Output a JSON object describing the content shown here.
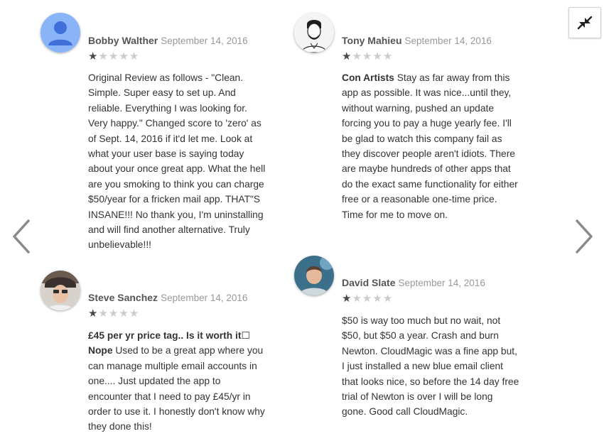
{
  "reviews": [
    {
      "name": "Bobby Walther",
      "date": "September 14, 2016",
      "rating": 1,
      "title": "",
      "text": "Original Review as follows - \"Clean. Simple. Super easy to set up. And reliable. Everything I was looking for. Very happy.\" Changed score to 'zero' as of Sept. 14, 2016 if it'd let me. Look at what your user base is saying today about your once great app. What the hell are you smoking to think you can charge $50/year for a fricken mail app. THAT\"S INSANE!!! No thank you, I'm uninstalling and will find another alternative. Truly unbelievable!!!"
    },
    {
      "name": "Tony Mahieu",
      "date": "September 14, 2016",
      "rating": 1,
      "title": "Con Artists",
      "text": "Stay as far away from this app as possible. It was nice...until they, without warning, pushed an update forcing you to pay a huge yearly fee. I'll be glad to watch this company fail as they discover people aren't idiots. There are maybe hundreds of other apps that do the exact same functionality for either free or a reasonable one-time price. Time for me to move on."
    },
    {
      "name": "Steve Sanchez",
      "date": "September 14, 2016",
      "rating": 1,
      "title": "£45 per yr price tag.. Is it worth it☐ Nope",
      "text": "Used to be a great app where you can manage multiple email accounts in one.... Just updated the app to encounter that I need to pay £45/yr in order to use it. I honestly don't know why they done this!"
    },
    {
      "name": "David Slate",
      "date": "September 14, 2016",
      "rating": 1,
      "title": "",
      "text": "$50 is way too much but no wait, not $50, but $50 a year. Crash and burn Newton. CloudMagic was a fine app but, I just installed a new blue email client that looks nice, so before the 14 day free trial of Newton is over I will be long gone. Good call CloudMagic."
    }
  ],
  "max_stars": 5,
  "icons": {
    "prev": "chevron-left-icon",
    "next": "chevron-right-icon",
    "collapse": "collapse-icon"
  },
  "colors": {
    "default_avatar_bg": "#8ab4f8",
    "default_avatar_fg": "#3f6fd8",
    "star_on": "#4a4a4a",
    "star_off": "#cccccc"
  }
}
